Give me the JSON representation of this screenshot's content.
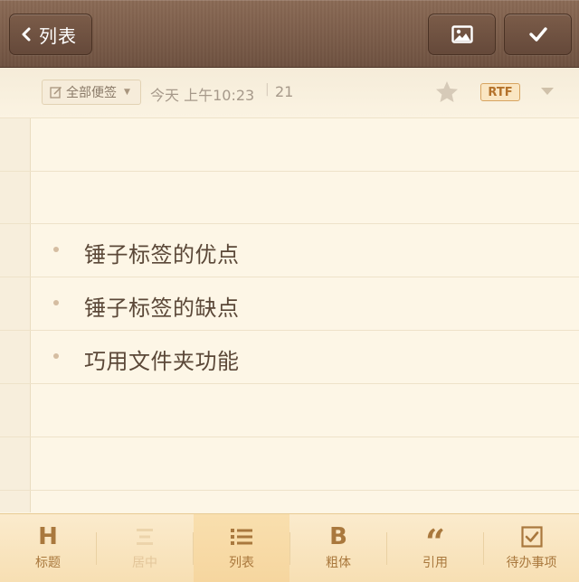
{
  "nav": {
    "back_label": "列表"
  },
  "meta": {
    "folder_label": "全部便签",
    "date": "今天 上午10:23",
    "count": "21",
    "format_badge": "RTF"
  },
  "items": [
    {
      "text": "锤子标签的优点"
    },
    {
      "text": "锤子标签的缺点"
    },
    {
      "text": "巧用文件夹功能"
    }
  ],
  "toolbar": {
    "tools": [
      {
        "label": "标题",
        "icon": "heading-icon",
        "state": "normal"
      },
      {
        "label": "居中",
        "icon": "align-center-icon",
        "state": "disabled"
      },
      {
        "label": "列表",
        "icon": "list-icon",
        "state": "active"
      },
      {
        "label": "粗体",
        "icon": "bold-icon",
        "state": "normal"
      },
      {
        "label": "引用",
        "icon": "quote-icon",
        "state": "normal"
      },
      {
        "label": "待办事项",
        "icon": "checkbox-icon",
        "state": "normal"
      }
    ]
  },
  "colors": {
    "accent": "#a9783d",
    "text": "#5b4838",
    "paper": "#fdf6e6",
    "topbar": "#7a5c48"
  }
}
